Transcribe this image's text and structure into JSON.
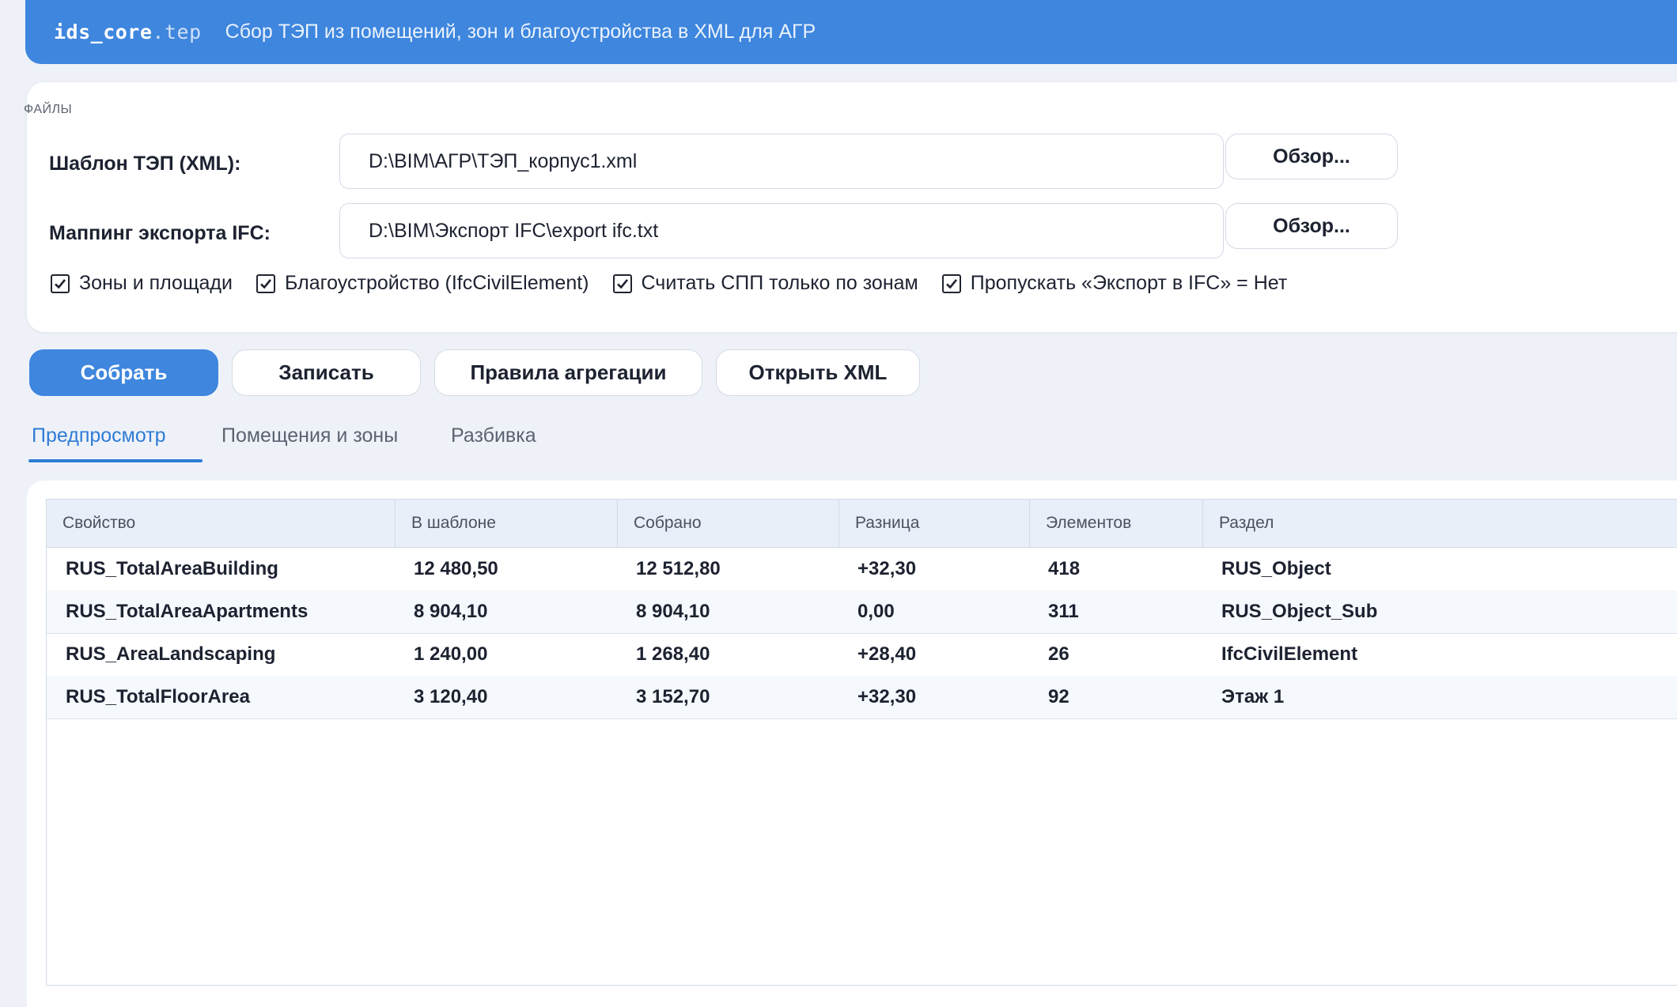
{
  "header": {
    "brand_main": "ids_core",
    "brand_ext": ".tep",
    "subtitle": "Сбор ТЭП из помещений, зон и благоустройства в XML для АГР"
  },
  "files": {
    "section_label": "ФАЙЛЫ",
    "template_label": "Шаблон ТЭП (XML):",
    "template_path": "D:\\BIM\\АГР\\ТЭП_корпус1.xml",
    "mapping_label": "Маппинг экспорта IFC:",
    "mapping_path": "D:\\BIM\\Экспорт IFC\\export ifc.txt",
    "browse_label": "Обзор..."
  },
  "options": [
    {
      "label": "Зоны и площади",
      "checked": true
    },
    {
      "label": "Благоустройство (IfcCivilElement)",
      "checked": true
    },
    {
      "label": "Считать СПП только по зонам",
      "checked": true
    },
    {
      "label": "Пропускать «Экспорт в IFC» = Нет",
      "checked": true
    }
  ],
  "actions": {
    "collect": "Собрать",
    "write": "Записать",
    "rules": "Правила агрегации",
    "open_xml": "Открыть XML"
  },
  "tabs": [
    {
      "label": "Предпросмотр",
      "active": true
    },
    {
      "label": "Помещения и зоны",
      "active": false
    },
    {
      "label": "Разбивка",
      "active": false
    }
  ],
  "table": {
    "columns": [
      "Свойство",
      "В шаблоне",
      "Собрано",
      "Разница",
      "Элементов",
      "Раздел"
    ],
    "rows": [
      [
        "RUS_TotalAreaBuilding",
        "12 480,50",
        "12 512,80",
        "+32,30",
        "418",
        "RUS_Object"
      ],
      [
        "RUS_TotalAreaApartments",
        "8 904,10",
        "8 904,10",
        "0,00",
        "311",
        "RUS_Object_Sub"
      ],
      [
        "RUS_AreaLandscaping",
        "1 240,00",
        "1 268,40",
        "+28,40",
        "26",
        "IfcCivilElement"
      ],
      [
        "RUS_TotalFloorArea",
        "3 120,40",
        "3 152,70",
        "+32,30",
        "92",
        "Этаж 1"
      ]
    ]
  },
  "colors": {
    "accent": "#3e86de",
    "background": "#eef2f8",
    "header_row": "#e8eff8"
  }
}
